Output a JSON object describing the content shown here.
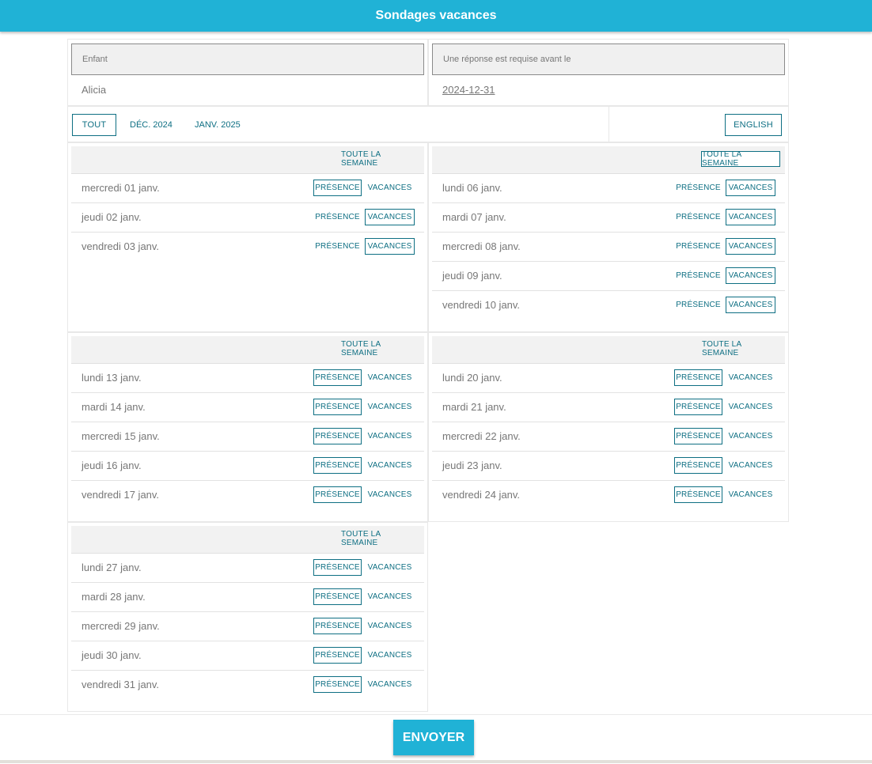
{
  "header": {
    "title": "Sondages vacances"
  },
  "info": {
    "child_label": "Enfant",
    "child_value": "Alicia",
    "deadline_label": "Une réponse est requise avant le",
    "deadline_value": "2024-12-31"
  },
  "filters": {
    "all": "TOUT",
    "dec": "DÉC. 2024",
    "jan": "JANV. 2025",
    "language": "ENGLISH"
  },
  "labels": {
    "whole_week": "TOUTE LA SEMAINE",
    "presence": "PRÉSENCE",
    "vacation": "VACANCES"
  },
  "weeks": [
    {
      "whole_week_selected": false,
      "days": [
        {
          "label": "mercredi 01 janv.",
          "selected": "presence"
        },
        {
          "label": "jeudi 02 janv.",
          "selected": "vacation"
        },
        {
          "label": "vendredi 03 janv.",
          "selected": "vacation"
        }
      ]
    },
    {
      "whole_week_selected": true,
      "days": [
        {
          "label": "lundi 06 janv.",
          "selected": "vacation"
        },
        {
          "label": "mardi 07 janv.",
          "selected": "vacation"
        },
        {
          "label": "mercredi 08 janv.",
          "selected": "vacation"
        },
        {
          "label": "jeudi 09 janv.",
          "selected": "vacation"
        },
        {
          "label": "vendredi 10 janv.",
          "selected": "vacation"
        }
      ]
    },
    {
      "whole_week_selected": false,
      "days": [
        {
          "label": "lundi 13 janv.",
          "selected": "presence"
        },
        {
          "label": "mardi 14 janv.",
          "selected": "presence"
        },
        {
          "label": "mercredi 15 janv.",
          "selected": "presence"
        },
        {
          "label": "jeudi 16 janv.",
          "selected": "presence"
        },
        {
          "label": "vendredi 17 janv.",
          "selected": "presence"
        }
      ]
    },
    {
      "whole_week_selected": false,
      "days": [
        {
          "label": "lundi 20 janv.",
          "selected": "presence"
        },
        {
          "label": "mardi 21 janv.",
          "selected": "presence"
        },
        {
          "label": "mercredi 22 janv.",
          "selected": "presence"
        },
        {
          "label": "jeudi 23 janv.",
          "selected": "presence"
        },
        {
          "label": "vendredi 24 janv.",
          "selected": "presence"
        }
      ]
    },
    {
      "whole_week_selected": false,
      "days": [
        {
          "label": "lundi 27 janv.",
          "selected": "presence"
        },
        {
          "label": "mardi 28 janv.",
          "selected": "presence"
        },
        {
          "label": "mercredi 29 janv.",
          "selected": "presence"
        },
        {
          "label": "jeudi 30 janv.",
          "selected": "presence"
        },
        {
          "label": "vendredi 31 janv.",
          "selected": "presence"
        }
      ]
    }
  ],
  "footer": {
    "submit": "ENVOYER"
  },
  "colors": {
    "primary": "#20b2d6",
    "accent": "#0e6f83"
  }
}
